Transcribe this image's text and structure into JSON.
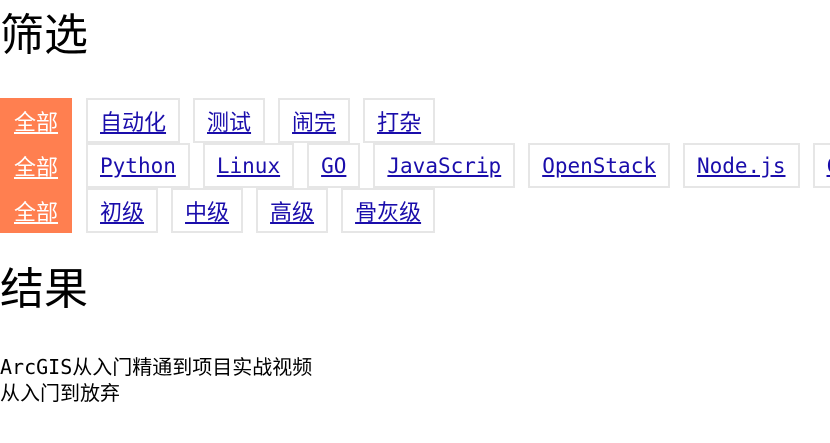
{
  "filter_title": "筛选",
  "result_title": "结果",
  "filters": {
    "row1": {
      "all_label": "全部",
      "items": [
        "自动化",
        "测试",
        "闹完",
        "打杂"
      ]
    },
    "row2": {
      "all_label": "全部",
      "items": [
        "Python",
        "Linux",
        "GO",
        "JavaScrip",
        "OpenStack",
        "Node.js",
        "C"
      ]
    },
    "row3": {
      "all_label": "全部",
      "items": [
        "初级",
        "中级",
        "高级",
        "骨灰级"
      ]
    }
  },
  "results": [
    "ArcGIS从入门精通到项目实战视频",
    "从入门到放弃"
  ],
  "colors": {
    "active_bg": "#ff7f50",
    "link": "#1a0dab",
    "chip_border": "#e6e6e6"
  }
}
